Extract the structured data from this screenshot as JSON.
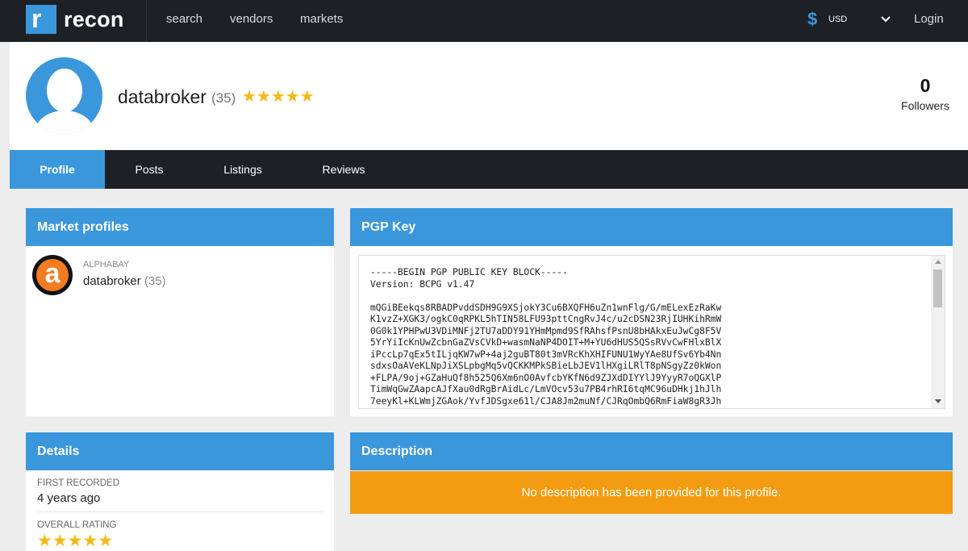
{
  "nav": {
    "logo_letter": "r",
    "brand": "recon",
    "links": [
      "search",
      "vendors",
      "markets"
    ],
    "currency_symbol": "$",
    "currency": "USD",
    "login": "Login"
  },
  "profile": {
    "username": "databroker",
    "review_count": "(35)",
    "rating_stars": "★★★★★",
    "followers_count": "0",
    "followers_label": "Followers"
  },
  "tabs": [
    "Profile",
    "Posts",
    "Listings",
    "Reviews"
  ],
  "market_profiles": {
    "title": "Market profiles",
    "items": [
      {
        "logo_letter": "a",
        "market": "ALPHABAY",
        "username": "databroker",
        "count": "(35)"
      }
    ]
  },
  "pgp": {
    "title": "PGP Key",
    "text": "-----BEGIN PGP PUBLIC KEY BLOCK-----\nVersion: BCPG v1.47\n\nmQGiBEekqs8RBADPvddSDH9G9XSjokY3Cu6BXQFH6uZn1wnFlg/G/mELexEzRaKw\nK1vzZ+XGK3/ogkC0qRPKL5hTIN58LFU93pttCngRvJ4c/u2cDSN23RjIUHKihRmW\n0G0k1YPHPwU3VDiMNFj2TU7aDDY91YHmMpmd9SfRAhsfPsnU8bHAkxEuJwCg8F5V\n5YrYiIcKnUwZcbnGaZVsCVkD+wasmNaNP4DOIT+M+YU6dHUS5QSsRVvCwFHlxBlX\niPccLp7qEx5tILjqKW7wP+4aj2guBT80t3mVRcKhXHIFUNU1WyYAe8UfSv6Yb4Nn\nsdxsOaAVeKLNpJiXSLpbgMq5vQCKKMPkSBieLbJEV1lHXgiLRlT8pNSgyZz0kWon\n+FLPA/9oj+GZaHuQf8h525Q6Xm6nO0AvfcbYKfN6d9ZJXdDIYYlJ9YyyR7oQGXlP\nTimWqGwZAapcAJfXau0dRgBrAidLc/LmVOcv53u7PB4rhRI6tqMC96uDHkj1hJlh\n7eeyKl+KLWmjZGAok/YvfJDSgxe61l/CJA8Jm2muNf/CJRqOmbQ6RmFiaW8gR3Jh"
  },
  "details": {
    "title": "Details",
    "first_recorded_label": "FIRST RECORDED",
    "first_recorded_value": "4 years ago",
    "overall_rating_label": "OVERALL RATING",
    "overall_rating_stars": "★★★★★"
  },
  "description": {
    "title": "Description",
    "text": "No description has been provided for this profile."
  }
}
